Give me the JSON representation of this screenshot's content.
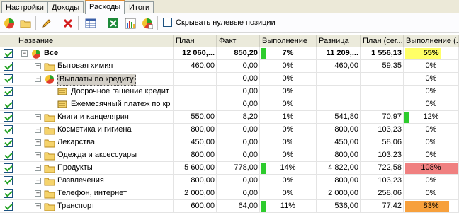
{
  "tabs": [
    "Настройки",
    "Доходы",
    "Расходы",
    "Итоги"
  ],
  "active_tab": "Расходы",
  "toolbar": {
    "hide_zero_label": "Скрывать нулевые позиции"
  },
  "columns": [
    "Название",
    "План",
    "Факт",
    "Выполнение",
    "Разница",
    "План (сег...",
    "Выполнение (..."
  ],
  "rows": [
    {
      "name": "Все",
      "bold": true,
      "plan": "12 060,...",
      "fact": "850,20",
      "exec": "7%",
      "diff": "11 209,...",
      "plan_seg": "1 556,13",
      "exec_seg": "55%",
      "exec_bar": "green",
      "exec_seg_bg": "yellow",
      "level": 0,
      "icon": "pie",
      "exp": "−"
    },
    {
      "name": "Бытовая химия",
      "plan": "460,00",
      "fact": "0,00",
      "exec": "0%",
      "diff": "460,00",
      "plan_seg": "59,35",
      "exec_seg": "0%",
      "level": 1,
      "icon": "folder",
      "exp": "+"
    },
    {
      "name": "Выплаты по кредиту",
      "plan": "",
      "fact": "0,00",
      "exec": "0%",
      "diff": "",
      "plan_seg": "",
      "exec_seg": "0%",
      "level": 1,
      "icon": "pie",
      "exp": "−",
      "selected": true
    },
    {
      "name": "Досрочное гашение кредит",
      "plan": "",
      "fact": "0,00",
      "exec": "0%",
      "diff": "",
      "plan_seg": "",
      "exec_seg": "0%",
      "level": 2,
      "icon": "doc"
    },
    {
      "name": "Ежемесячный платеж по кр",
      "plan": "",
      "fact": "0,00",
      "exec": "0%",
      "diff": "",
      "plan_seg": "",
      "exec_seg": "0%",
      "level": 2,
      "icon": "doc"
    },
    {
      "name": "Книги и канцелярия",
      "plan": "550,00",
      "fact": "8,20",
      "exec": "1%",
      "diff": "541,80",
      "plan_seg": "70,97",
      "exec_seg": "12%",
      "exec_seg_bar": "green",
      "level": 1,
      "icon": "folder",
      "exp": "+"
    },
    {
      "name": "Косметика и гигиена",
      "plan": "800,00",
      "fact": "0,00",
      "exec": "0%",
      "diff": "800,00",
      "plan_seg": "103,23",
      "exec_seg": "0%",
      "level": 1,
      "icon": "folder",
      "exp": "+"
    },
    {
      "name": "Лекарства",
      "plan": "450,00",
      "fact": "0,00",
      "exec": "0%",
      "diff": "450,00",
      "plan_seg": "58,06",
      "exec_seg": "0%",
      "level": 1,
      "icon": "folder",
      "exp": "+"
    },
    {
      "name": "Одежда и аксессуары",
      "plan": "800,00",
      "fact": "0,00",
      "exec": "0%",
      "diff": "800,00",
      "plan_seg": "103,23",
      "exec_seg": "0%",
      "level": 1,
      "icon": "folder",
      "exp": "+"
    },
    {
      "name": "Продукты",
      "plan": "5 600,00",
      "fact": "778,00",
      "exec": "14%",
      "diff": "4 822,00",
      "plan_seg": "722,58",
      "exec_seg": "108%",
      "exec_bar": "green",
      "exec_seg_bg": "red",
      "level": 1,
      "icon": "folder",
      "exp": "+"
    },
    {
      "name": "Развлечения",
      "plan": "800,00",
      "fact": "0,00",
      "exec": "0%",
      "diff": "800,00",
      "plan_seg": "103,23",
      "exec_seg": "0%",
      "level": 1,
      "icon": "folder",
      "exp": "+"
    },
    {
      "name": "Телефон, интернет",
      "plan": "2 000,00",
      "fact": "0,00",
      "exec": "0%",
      "diff": "2 000,00",
      "plan_seg": "258,06",
      "exec_seg": "0%",
      "level": 1,
      "icon": "folder",
      "exp": "+"
    },
    {
      "name": "Транспорт",
      "plan": "600,00",
      "fact": "64,00",
      "exec": "11%",
      "diff": "536,00",
      "plan_seg": "77,42",
      "exec_seg": "83%",
      "exec_bar": "green",
      "exec_seg_bg": "orange",
      "level": 1,
      "icon": "folder",
      "exp": "+"
    }
  ],
  "colors": {
    "green": "#2dcc2d",
    "yellow": "#ffff66",
    "red": "#f08080",
    "orange": "#f7a03c",
    "tab_accent": "#e68b2c"
  }
}
